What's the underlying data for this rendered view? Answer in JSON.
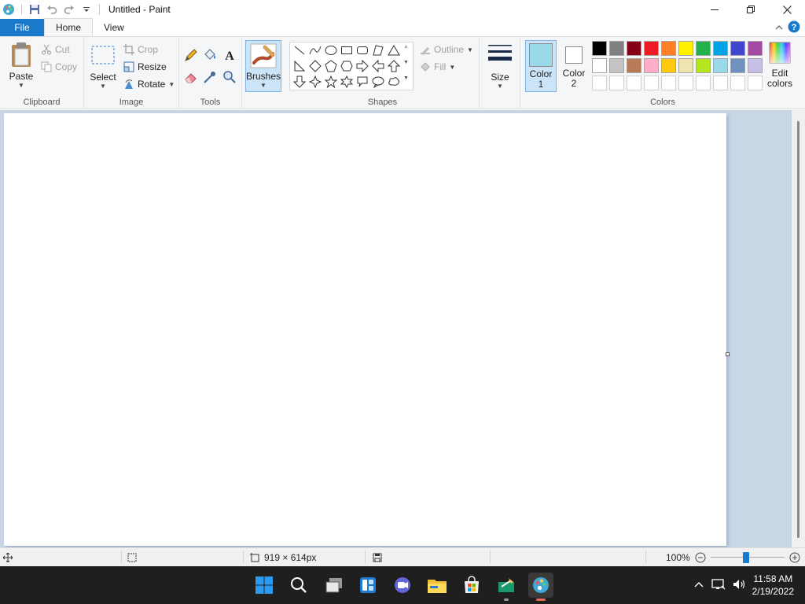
{
  "window": {
    "title": "Untitled - Paint"
  },
  "quick_access": {
    "icons": [
      "paint-app-icon",
      "save-icon",
      "undo-icon",
      "redo-icon",
      "customize-qat-icon"
    ]
  },
  "tabs": {
    "file": "File",
    "home": "Home",
    "view": "View"
  },
  "clipboard": {
    "paste": "Paste",
    "cut": "Cut",
    "copy": "Copy",
    "label": "Clipboard"
  },
  "image": {
    "select": "Select",
    "crop": "Crop",
    "resize": "Resize",
    "rotate": "Rotate",
    "label": "Image"
  },
  "tools": {
    "label": "Tools"
  },
  "brushes": {
    "label": "Brushes"
  },
  "shapes": {
    "outline": "Outline",
    "fill": "Fill",
    "label": "Shapes"
  },
  "size": {
    "label": "Size"
  },
  "colors": {
    "color1_line1": "Color",
    "color1_line2": "1",
    "color2_line1": "Color",
    "color2_line2": "2",
    "edit_line1": "Edit",
    "edit_line2": "colors",
    "label": "Colors",
    "color1_value": "#99d9ea",
    "color2_value": "#ffffff",
    "palette_row1": [
      "#000000",
      "#7f7f7f",
      "#880015",
      "#ed1c24",
      "#ff7f27",
      "#fff200",
      "#22b14c",
      "#00a2e8",
      "#3f48cc",
      "#a349a4"
    ],
    "palette_row2": [
      "#ffffff",
      "#c3c3c3",
      "#b97a57",
      "#ffaec9",
      "#ffc90e",
      "#efe4b0",
      "#b5e61d",
      "#99d9ea",
      "#7092be",
      "#c8bfe7"
    ],
    "palette_row3": [
      "#ffffff",
      "#ffffff",
      "#ffffff",
      "#ffffff",
      "#ffffff",
      "#ffffff",
      "#ffffff",
      "#ffffff",
      "#ffffff",
      "#ffffff"
    ]
  },
  "status": {
    "image_size": "919 × 614px",
    "zoom": "100%"
  },
  "taskbar": {
    "time": "11:58 AM",
    "date": "2/19/2022"
  }
}
